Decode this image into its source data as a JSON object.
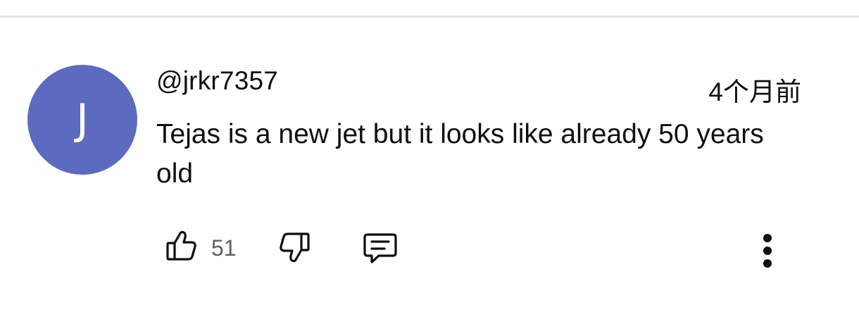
{
  "comment": {
    "avatar_letter": "J",
    "avatar_color": "#5c6bc0",
    "author": "@jrkr7357",
    "time": "4个月前",
    "text": "Tejas is a new jet but it looks like already 50 years old",
    "like_count": "51"
  },
  "icons": {
    "like": "thumbs-up-icon",
    "dislike": "thumbs-down-icon",
    "reply": "reply-comment-icon",
    "more": "more-vertical-icon"
  },
  "colors": {
    "text_primary": "#0f0f0f",
    "text_secondary": "#606060",
    "divider": "#e5e5e5"
  }
}
